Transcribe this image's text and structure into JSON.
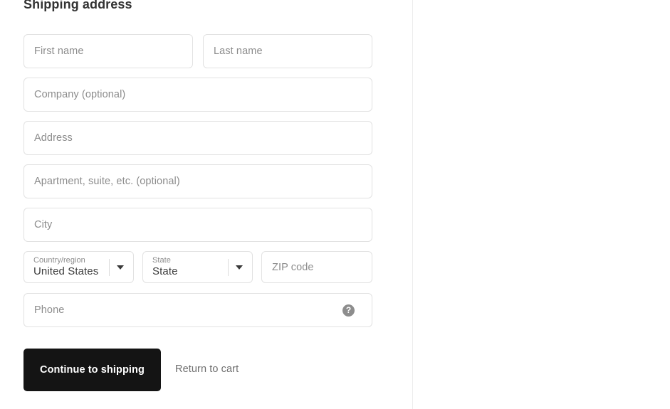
{
  "section": {
    "heading": "Shipping address"
  },
  "fields": {
    "first_name": {
      "placeholder": "First name"
    },
    "last_name": {
      "placeholder": "Last name"
    },
    "company": {
      "placeholder": "Company (optional)"
    },
    "address": {
      "placeholder": "Address"
    },
    "apartment": {
      "placeholder": "Apartment, suite, etc. (optional)"
    },
    "city": {
      "placeholder": "City"
    },
    "country": {
      "label": "Country/region",
      "value": "United States",
      "chevron_icon": "chevron-down-icon"
    },
    "state": {
      "label": "State",
      "value": "State",
      "chevron_icon": "chevron-down-icon"
    },
    "zip": {
      "placeholder": "ZIP code"
    },
    "phone": {
      "placeholder": "Phone",
      "help_icon": "help-circle-icon",
      "help_glyph": "?"
    }
  },
  "actions": {
    "continue_label": "Continue to shipping",
    "return_label": "Return to cart"
  },
  "colors": {
    "primary_button_bg": "#141414",
    "field_border": "#e2e2e2",
    "placeholder_text": "#8c8c8c",
    "divider": "#ececec"
  }
}
